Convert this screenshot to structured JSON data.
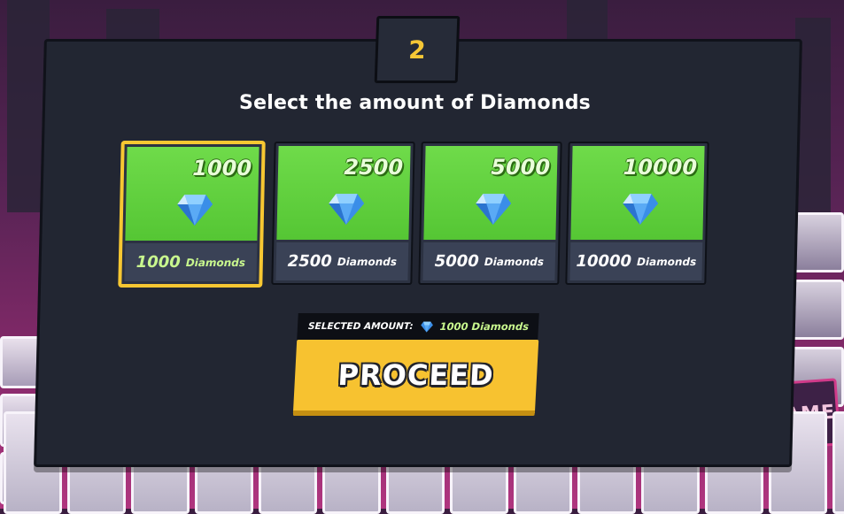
{
  "step": {
    "number": "2"
  },
  "title": "Select the amount of Diamonds",
  "cards": [
    {
      "amount": "1000",
      "count": "1000",
      "unit": "Diamonds",
      "selected": true
    },
    {
      "amount": "2500",
      "count": "2500",
      "unit": "Diamonds",
      "selected": false
    },
    {
      "amount": "5000",
      "count": "5000",
      "unit": "Diamonds",
      "selected": false
    },
    {
      "amount": "10000",
      "count": "10000",
      "unit": "Diamonds",
      "selected": false
    }
  ],
  "selection": {
    "label": "SELECTED AMOUNT:",
    "value": "1000 Diamonds"
  },
  "proceed_label": "PROCEED",
  "background": {
    "fame_label": "FAME"
  },
  "colors": {
    "accent": "#f7c230",
    "card_green": "#6fdb4a",
    "panel": "#222632",
    "selected_text": "#c8f78e"
  },
  "icons": {
    "gem": "diamond-icon"
  }
}
